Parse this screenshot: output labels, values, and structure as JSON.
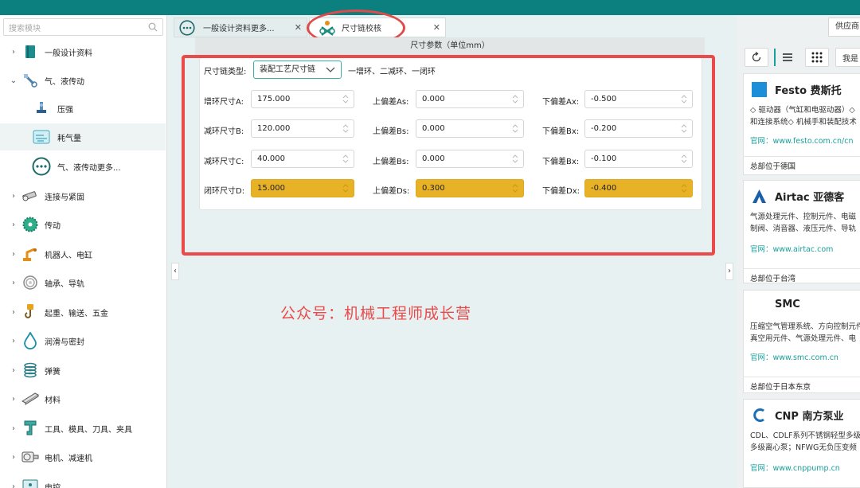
{
  "colors": {
    "accent": "#0c7f7f",
    "highlight": "#e8b227",
    "annotation": "#ea4a4a",
    "link": "#1aa09a"
  },
  "sidebar": {
    "search_placeholder": "搜索模块",
    "items": [
      {
        "label": "一般设计资料",
        "icon": "book-icon"
      },
      {
        "label": "气、液传动",
        "icon": "pneumatic-icon"
      },
      {
        "label": "压强",
        "icon": "pressure-icon"
      },
      {
        "label": "耗气量",
        "icon": "air-consumption-icon"
      },
      {
        "label": "气、液传动更多...",
        "icon": "more-icon"
      },
      {
        "label": "连接与紧固",
        "icon": "bolt-icon"
      },
      {
        "label": "传动",
        "icon": "gear-icon"
      },
      {
        "label": "机器人、电缸",
        "icon": "robot-icon"
      },
      {
        "label": "轴承、导轨",
        "icon": "bearing-icon"
      },
      {
        "label": "起重、输送、五金",
        "icon": "hook-icon"
      },
      {
        "label": "润滑与密封",
        "icon": "drop-icon"
      },
      {
        "label": "弹簧",
        "icon": "spring-icon"
      },
      {
        "label": "材料",
        "icon": "beam-icon"
      },
      {
        "label": "工具、模具、刀具、夹具",
        "icon": "clamp-icon"
      },
      {
        "label": "电机、减速机",
        "icon": "motor-icon"
      },
      {
        "label": "电控",
        "icon": "control-icon"
      }
    ]
  },
  "tabs": [
    {
      "label": "一般设计资料更多..."
    },
    {
      "label": "尺寸链校核"
    }
  ],
  "panel": {
    "header": "尺寸参数（单位mm）",
    "chain_type_label": "尺寸链类型:",
    "chain_type_value": "装配工艺尺寸链",
    "chain_type_desc": "一增环、二减环、一闭环",
    "rows": [
      {
        "label": "增环尺寸A:",
        "value": "175.000",
        "upper_label": "上偏差As:",
        "upper": "0.000",
        "lower_label": "下偏差Ax:",
        "lower": "-0.500"
      },
      {
        "label": "减环尺寸B:",
        "value": "120.000",
        "upper_label": "上偏差Bs:",
        "upper": "0.000",
        "lower_label": "下偏差Bx:",
        "lower": "-0.200"
      },
      {
        "label": "减环尺寸C:",
        "value": "40.000",
        "upper_label": "上偏差Bs:",
        "upper": "0.000",
        "lower_label": "下偏差Bx:",
        "lower": "-0.100"
      },
      {
        "label": "闭环尺寸D:",
        "value": "15.000",
        "upper_label": "上偏差Ds:",
        "upper": "0.300",
        "lower_label": "下偏差Dx:",
        "lower": "-0.400"
      }
    ]
  },
  "watermark": "公众号：机械工程师成长营",
  "right": {
    "tab_label": "供应商",
    "filter_label": "我是",
    "suppliers": [
      {
        "name": "Festo 费斯托",
        "desc1": "◇ 驱动器（气缸和电驱动器）◇",
        "desc2": "和连接系统◇ 机械手和装配技术",
        "web": "官网：www.festo.com.cn/cn",
        "hq": "总部位于德国"
      },
      {
        "name": "Airtac 亚德客",
        "desc1": "气源处理元件、控制元件、电磁",
        "desc2": "制阀、消音器、液压元件、导轨",
        "web": "官网：www.airtac.com",
        "hq": "总部位于台湾"
      },
      {
        "name": "SMC",
        "desc1": "压缩空气管理系统、方向控制元件",
        "desc2": "真空用元件、气源处理元件、电",
        "web": "官网：www.smc.com.cn",
        "hq": "总部位于日本东京"
      },
      {
        "name": "CNP 南方泵业",
        "desc1": "CDL、CDLF系列不锈钢轻型多级",
        "desc2": "多级离心泵；NFWG无负压变频",
        "web": "官网：www.cnppump.cn",
        "hq": ""
      }
    ]
  }
}
